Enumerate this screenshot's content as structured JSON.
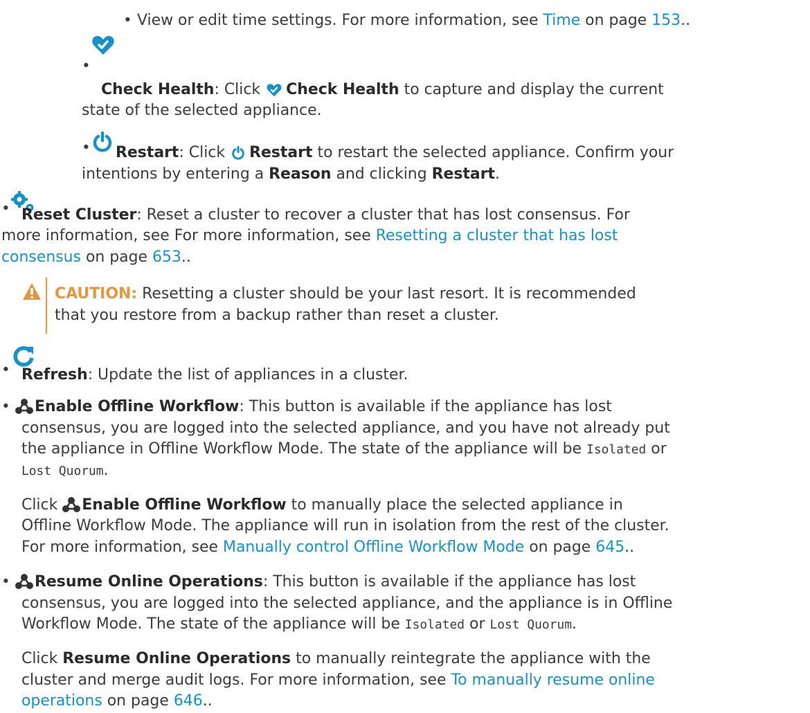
{
  "colors": {
    "link": "#1592c9",
    "caution": "#e8963e",
    "text": "#3c3c3c"
  },
  "sub": {
    "time": {
      "text1": "View or edit time settings. For more information, see ",
      "link": "Time",
      "text2": " on page ",
      "page": "153",
      "text3": ".."
    },
    "check_health": {
      "icon": "heart-icon",
      "title": "Check Health",
      "text1": ": Click ",
      "title2": "Check Health",
      "text2": " to capture and display the current",
      "text3": "state of the selected appliance."
    },
    "restart": {
      "icon": "power-icon",
      "title": "Restart",
      "text1": ": Click ",
      "title2": "Restart",
      "text2": " to restart the selected appliance. Confirm your",
      "text3": "intentions by entering a ",
      "reason": "Reason",
      "text4": " and clicking  ",
      "restart3": "Restart",
      "text5": "."
    }
  },
  "items": {
    "reset_cluster": {
      "icon": "gears-icon",
      "title": "Reset Cluster",
      "text1": ": Reset a cluster to recover a cluster that has lost consensus. For",
      "text2": "more information, see For more information, see ",
      "link1": "Resetting a cluster that has lost",
      "link2": "consensus",
      "text3": " on page ",
      "page": "653",
      "text4": ".."
    },
    "caution": {
      "icon": "warning-icon",
      "label": "CAUTION:",
      "text1": " Resetting a cluster should be your last resort. It is recommended",
      "text2": "that you restore from a backup rather than reset a cluster."
    },
    "refresh": {
      "icon": "refresh-icon",
      "title": "Refresh",
      "text1": ": Update the list of appliances in a cluster."
    },
    "enable_offline": {
      "icon": "nodes-icon",
      "title": "Enable Offline Workflow",
      "text1": ": This button is available if the appliance has lost",
      "text2": "consensus, you are logged into the selected appliance, and you have not already put",
      "text3": "the appliance in Offline Workflow Mode. The state of the appliance will be ",
      "code1": "Isolated",
      "text4": " or",
      "code2": "Lost Quorum",
      "text5": ".",
      "p2_text1": "Click ",
      "p2_title": "Enable Offline Workflow",
      "p2_text2": "  to manually place the selected appliance in",
      "p2_text3": "Offline Workflow Mode. The appliance will run in isolation from the rest of the cluster.",
      "p2_text4": "For more information, see ",
      "p2_link": "Manually control Offline Workflow Mode",
      "p2_text5": " on page ",
      "p2_page": "645",
      "p2_text6": ".."
    },
    "resume_online": {
      "icon": "nodes-outline-icon",
      "title": "Resume Online Operations",
      "text1": ": This button is available if the appliance has lost",
      "text2": "consensus, you are logged into the selected appliance, and the appliance is in Offline",
      "text3": "Workflow Mode. The state of the appliance will be ",
      "code1": "Isolated",
      "text4": " or ",
      "code2": "Lost Quorum",
      "text5": ".",
      "p2_text1": "Click ",
      "p2_title": "Resume Online Operations",
      "p2_text2": " to manually reintegrate the appliance with the",
      "p2_text3": "cluster and merge audit logs. For more information, see ",
      "p2_link1": "To manually resume online",
      "p2_link2": "operations",
      "p2_text4": " on page ",
      "p2_page": "646",
      "p2_text5": ".."
    }
  }
}
